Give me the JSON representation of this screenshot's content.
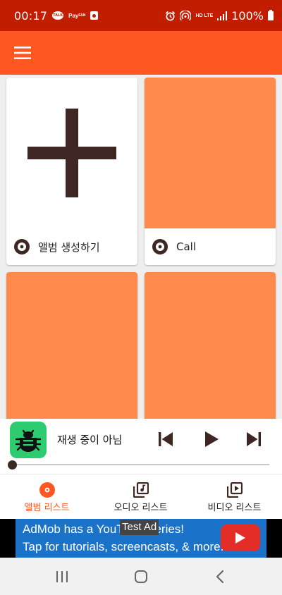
{
  "status_bar": {
    "time": "00:17",
    "talk_badge": "TALK",
    "pay_badge": "Pay",
    "pay_sub": "FAN",
    "hd_label": "HD",
    "lte_label": "LTE",
    "battery": "100%"
  },
  "app_bar": {
    "menu_icon": "hamburger-menu-icon",
    "color": "#ff5722"
  },
  "albums": [
    {
      "label": "앨범 생성하기",
      "icon": "disc-icon",
      "media": "plus-icon"
    },
    {
      "label": "Call",
      "icon": "disc-icon",
      "media": "orange-cover"
    },
    {
      "label": "",
      "media": "orange-cover"
    },
    {
      "label": "",
      "media": "orange-cover"
    }
  ],
  "player": {
    "status_text": "재생 중이 아님",
    "album_art_icon": "bug-icon",
    "progress": 0
  },
  "bottom_nav": {
    "items": [
      {
        "label": "앨범 리스트",
        "icon": "album-icon",
        "active": true
      },
      {
        "label": "오디오 리스트",
        "icon": "music-note-icon",
        "active": false
      },
      {
        "label": "비디오 리스트",
        "icon": "video-icon",
        "active": false
      }
    ]
  },
  "ad": {
    "line1": "AdMob has a YouTube Series!",
    "line2": "Tap for tutorials, screencasts, & more.",
    "test_label": "Test Ad"
  },
  "colors": {
    "accent": "#ff5722",
    "status_bar": "#c21d00",
    "card_cover": "#ff8a4c",
    "dark_brown": "#3e2723"
  }
}
